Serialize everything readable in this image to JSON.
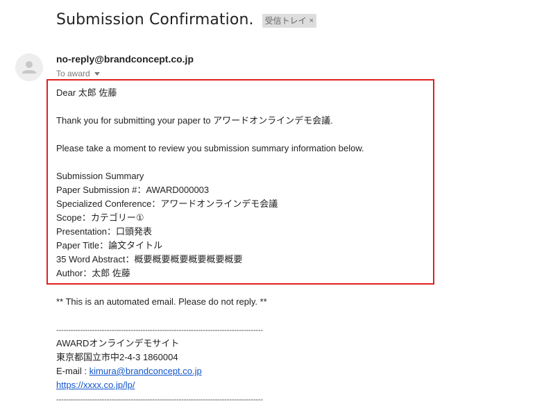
{
  "email": {
    "subject": "Submission Confirmation.",
    "label_chip": "受信トレイ",
    "label_close": "×",
    "sender": "no-reply@brandconcept.co.jp",
    "to_text": "To award"
  },
  "body": {
    "greeting": "Dear 太郎 佐藤",
    "thanks": "Thank you for submitting your paper to アワードオンラインデモ会議.",
    "review": "Please take a moment to review you submission summary information below.",
    "summary_title": "Submission Summary",
    "summary_lines": [
      "Paper Submission #：AWARD000003",
      "Specialized Conference：アワードオンラインデモ会議",
      "Scope：カテゴリー①",
      "Presentation：口頭発表",
      "Paper Title：論文タイトル",
      "35 Word Abstract：概要概要概要概要概要概要",
      "Author：太郎 佐藤"
    ],
    "automated_notice": "** This is an automated email. Please do not reply. **"
  },
  "signature": {
    "divider": "--------------------------------------------------------------------------------------",
    "site_name": "AWARDオンラインデモサイト",
    "address": "東京都国立市中2-4-3 1860004",
    "email_prefix": "E-mail : ",
    "email_link": "kimura@brandconcept.co.jp",
    "url_link": "https://xxxx.co.jp/lp/"
  },
  "colors": {
    "highlight_border": "#e02020",
    "link": "#1155cc"
  }
}
